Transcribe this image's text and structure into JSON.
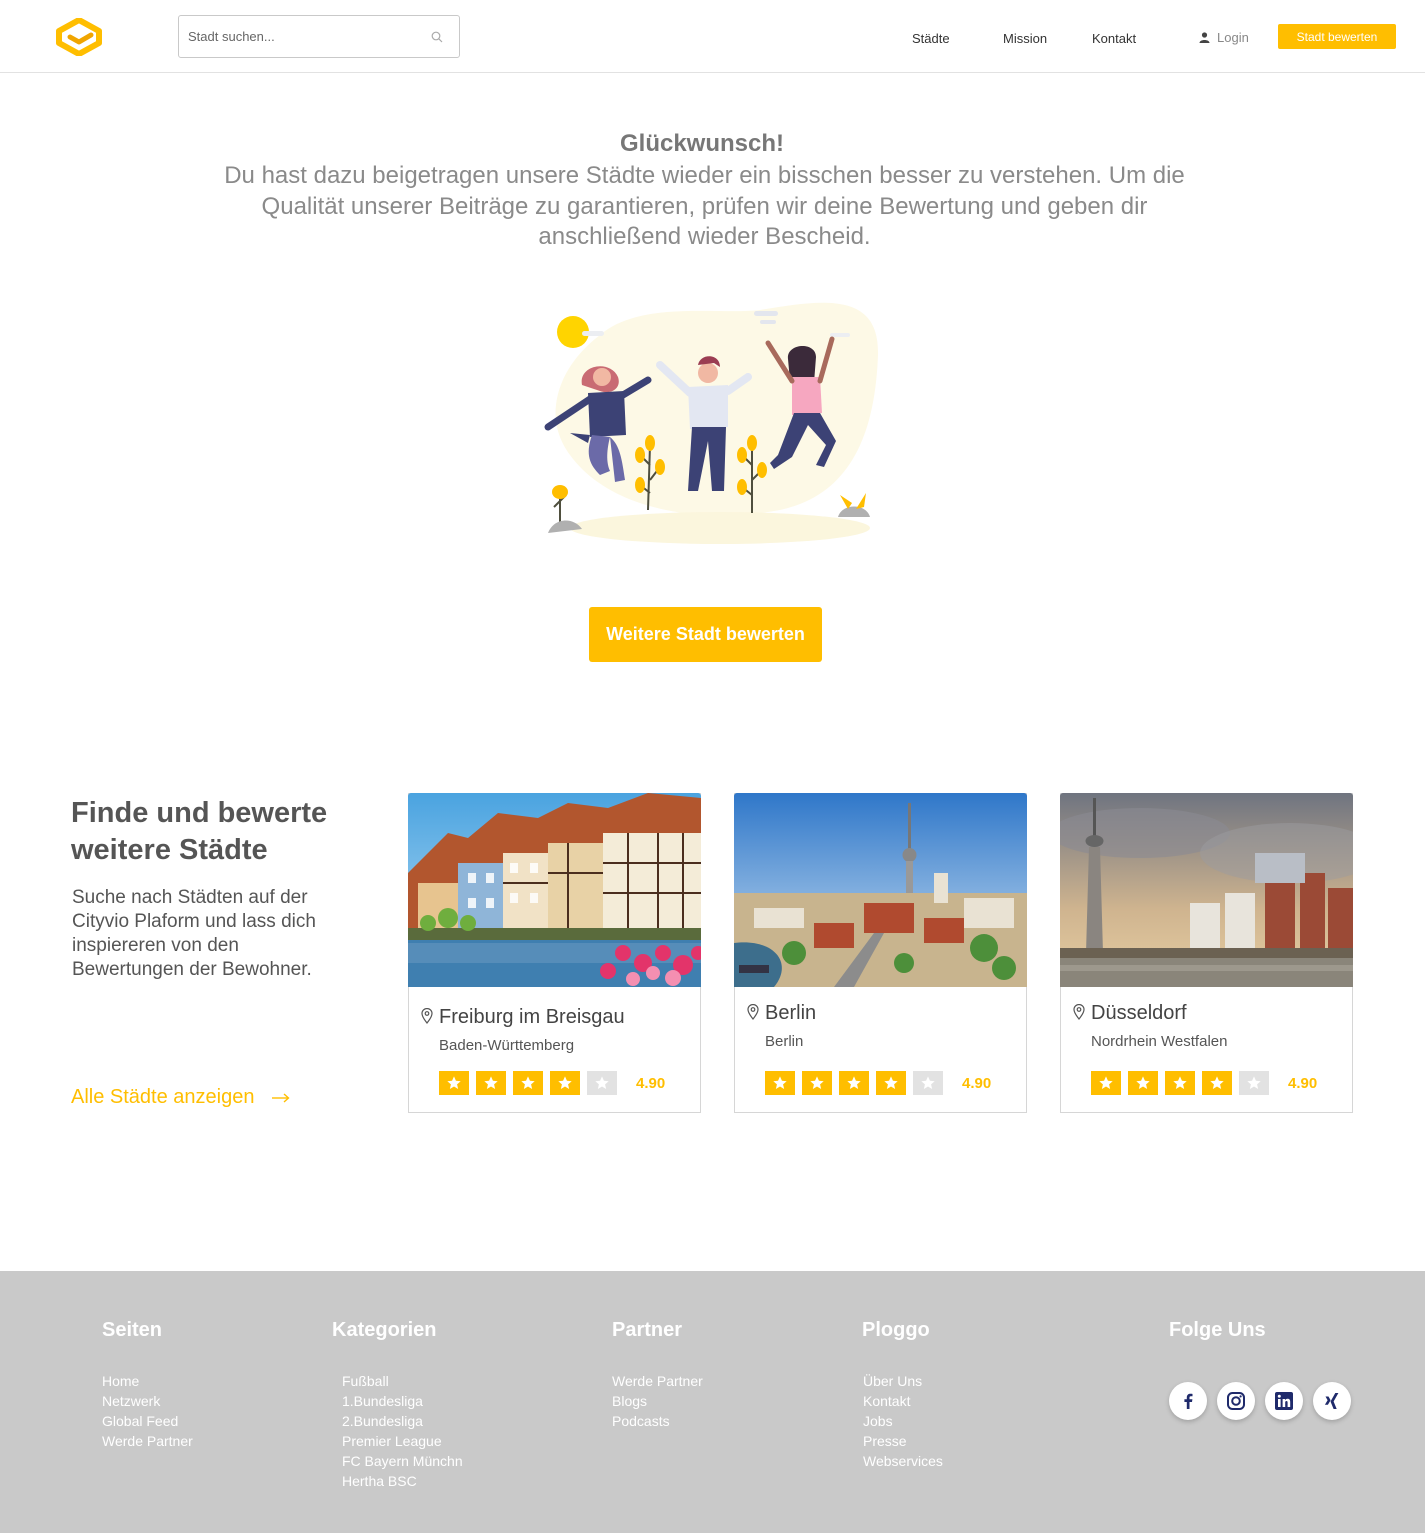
{
  "header": {
    "search_placeholder": "Stadt suchen...",
    "nav": [
      "Städte",
      "Mission",
      "Kontakt"
    ],
    "login_label": "Login",
    "cta_label": "Stadt bewerten"
  },
  "congrats": {
    "title": "Glückwunsch!",
    "text": "Du hast dazu beigetragen unsere Städte wieder ein bisschen besser zu verstehen. Um die Qualität unserer Beiträge zu garantieren, prüfen wir deine Bewertung und geben dir anschließend wieder Bescheid.",
    "cta_label": "Weitere Stadt bewerten"
  },
  "cities_section": {
    "title": "Finde und bewerte weitere Städte",
    "text": "Suche nach Städten auf der Cityvio Plaform und lass dich inspiereren von den Bewertungen der Bewohner.",
    "all_link": "Alle Städte anzeigen",
    "cards": [
      {
        "city": "Freiburg im Breisgau",
        "region": "Baden-Württemberg",
        "score": "4.90",
        "stars_filled": 4,
        "stars_total": 5,
        "photo_icon": "half-timbered-houses-photo"
      },
      {
        "city": "Berlin",
        "region": "Berlin",
        "score": "4.90",
        "stars_filled": 4,
        "stars_total": 5,
        "photo_icon": "tv-tower-skyline-photo"
      },
      {
        "city": "Düsseldorf",
        "region": "Nordrhein Westfalen",
        "score": "4.90",
        "stars_filled": 4,
        "stars_total": 5,
        "photo_icon": "rhine-tower-harbour-photo"
      }
    ]
  },
  "footer": {
    "columns": [
      {
        "title": "Seiten",
        "items": [
          "Home",
          "Netzwerk",
          "Global Feed",
          "Werde Partner"
        ]
      },
      {
        "title": "Kategorien",
        "items": [
          "Fußball",
          "1.Bundesliga",
          "2.Bundesliga",
          "Premier League",
          "FC Bayern Münchn",
          "Hertha BSC"
        ]
      },
      {
        "title": "Partner",
        "items": [
          "Werde Partner",
          "Blogs",
          "Podcasts"
        ]
      },
      {
        "title": "Ploggo",
        "items": [
          "Über Uns",
          "Kontakt",
          "Jobs",
          "Presse",
          "Webservices"
        ]
      }
    ],
    "social_title": "Folge Uns",
    "social_icons": [
      "facebook-icon",
      "instagram-icon",
      "linkedin-icon",
      "xing-icon"
    ]
  },
  "colors": {
    "accent": "#ffbe00",
    "footer_bg": "#c9c9c9",
    "social_icon": "#1f2a6b",
    "text": "#555555"
  }
}
